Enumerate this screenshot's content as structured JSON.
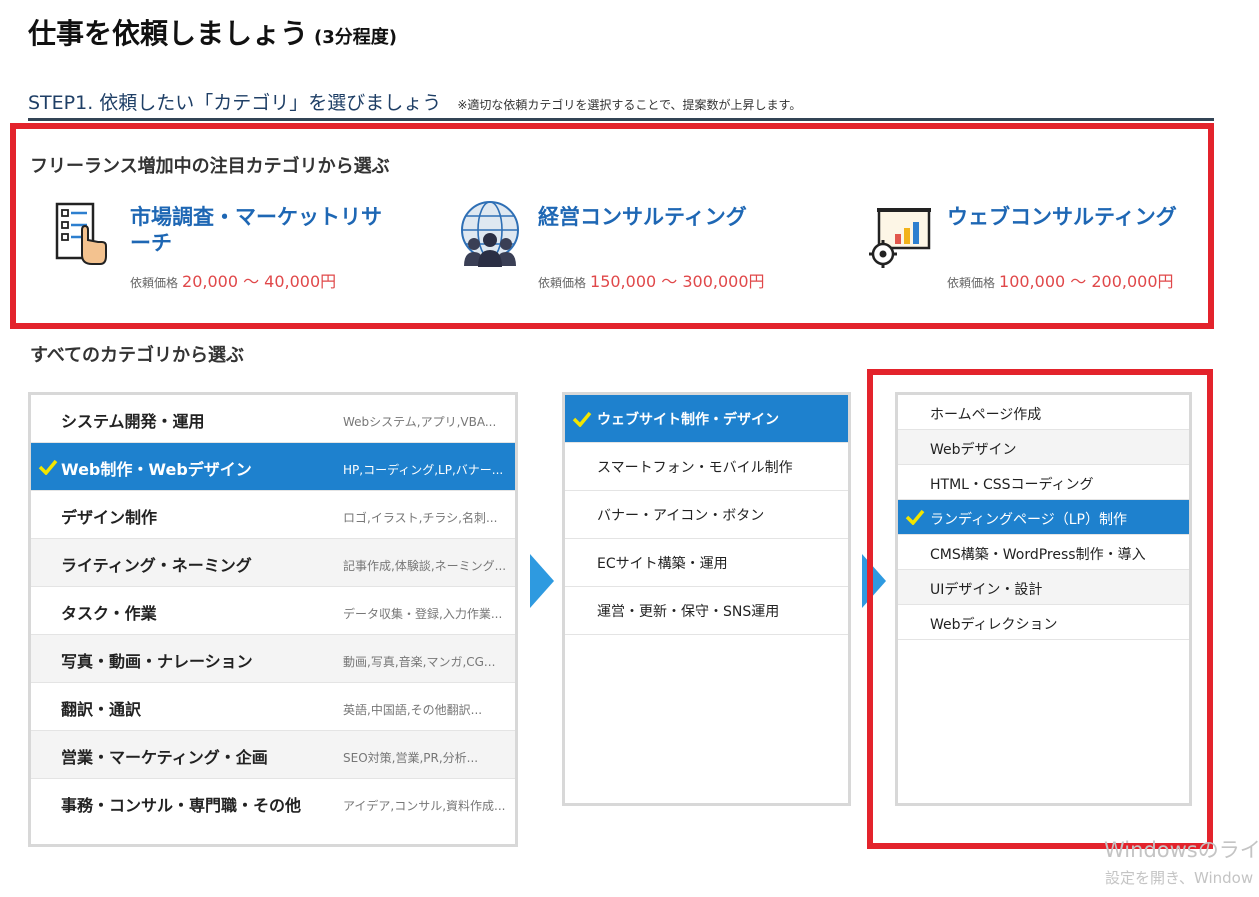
{
  "header": {
    "title": "仕事を依頼しましょう",
    "duration": "(3分程度)"
  },
  "step": {
    "label": "STEP1. 依頼したい「カテゴリ」を選びましょう",
    "note": "※適切な依頼カテゴリを選択することで、提案数が上昇します。"
  },
  "featured": {
    "title": "フリーランス増加中の注目カテゴリから選ぶ",
    "price_label": "依頼価格",
    "items": [
      {
        "name": "市場調査・マーケットリサーチ",
        "price": "20,000 〜 40,000円",
        "icon": "checklist-hand-icon"
      },
      {
        "name": "経営コンサルティング",
        "price": "150,000 〜 300,000円",
        "icon": "globe-people-icon"
      },
      {
        "name": "ウェブコンサルティング",
        "price": "100,000 〜 200,000円",
        "icon": "presentation-board-gear-icon"
      }
    ]
  },
  "all": {
    "title": "すべてのカテゴリから選ぶ",
    "categories": [
      {
        "label": "システム開発・運用",
        "desc": "Webシステム,アプリ,VBA..."
      },
      {
        "label": "Web制作・Webデザイン",
        "desc": "HP,コーディング,LP,バナー..."
      },
      {
        "label": "デザイン制作",
        "desc": "ロゴ,イラスト,チラシ,名刺..."
      },
      {
        "label": "ライティング・ネーミング",
        "desc": "記事作成,体験談,ネーミング..."
      },
      {
        "label": "タスク・作業",
        "desc": "データ収集・登録,入力作業..."
      },
      {
        "label": "写真・動画・ナレーション",
        "desc": "動画,写真,音楽,マンガ,CG..."
      },
      {
        "label": "翻訳・通訳",
        "desc": "英語,中国語,その他翻訳..."
      },
      {
        "label": "営業・マーケティング・企画",
        "desc": "SEO対策,営業,PR,分析..."
      },
      {
        "label": "事務・コンサル・専門職・その他",
        "desc": "アイデア,コンサル,資料作成..."
      }
    ],
    "subcategories": [
      "ウェブサイト制作・デザイン",
      "スマートフォン・モバイル制作",
      "バナー・アイコン・ボタン",
      "ECサイト構築・運用",
      "運営・更新・保守・SNS運用"
    ],
    "details": [
      "ホームページ作成",
      "Webデザイン",
      "HTML・CSSコーディング",
      "ランディングページ（LP）制作",
      "CMS構築・WordPress制作・導入",
      "UIデザイン・設計",
      "Webディレクション"
    ]
  },
  "watermark": {
    "line1": "Windowsのライ",
    "line2": "設定を開き、Window"
  },
  "colors": {
    "accent_blue": "#1e81ce",
    "link_blue": "#1e67b4",
    "price_red": "#e0484a",
    "highlight_red": "#e3232c",
    "check_yellow": "#f2e500",
    "arrow_blue": "#2e9ae0"
  }
}
